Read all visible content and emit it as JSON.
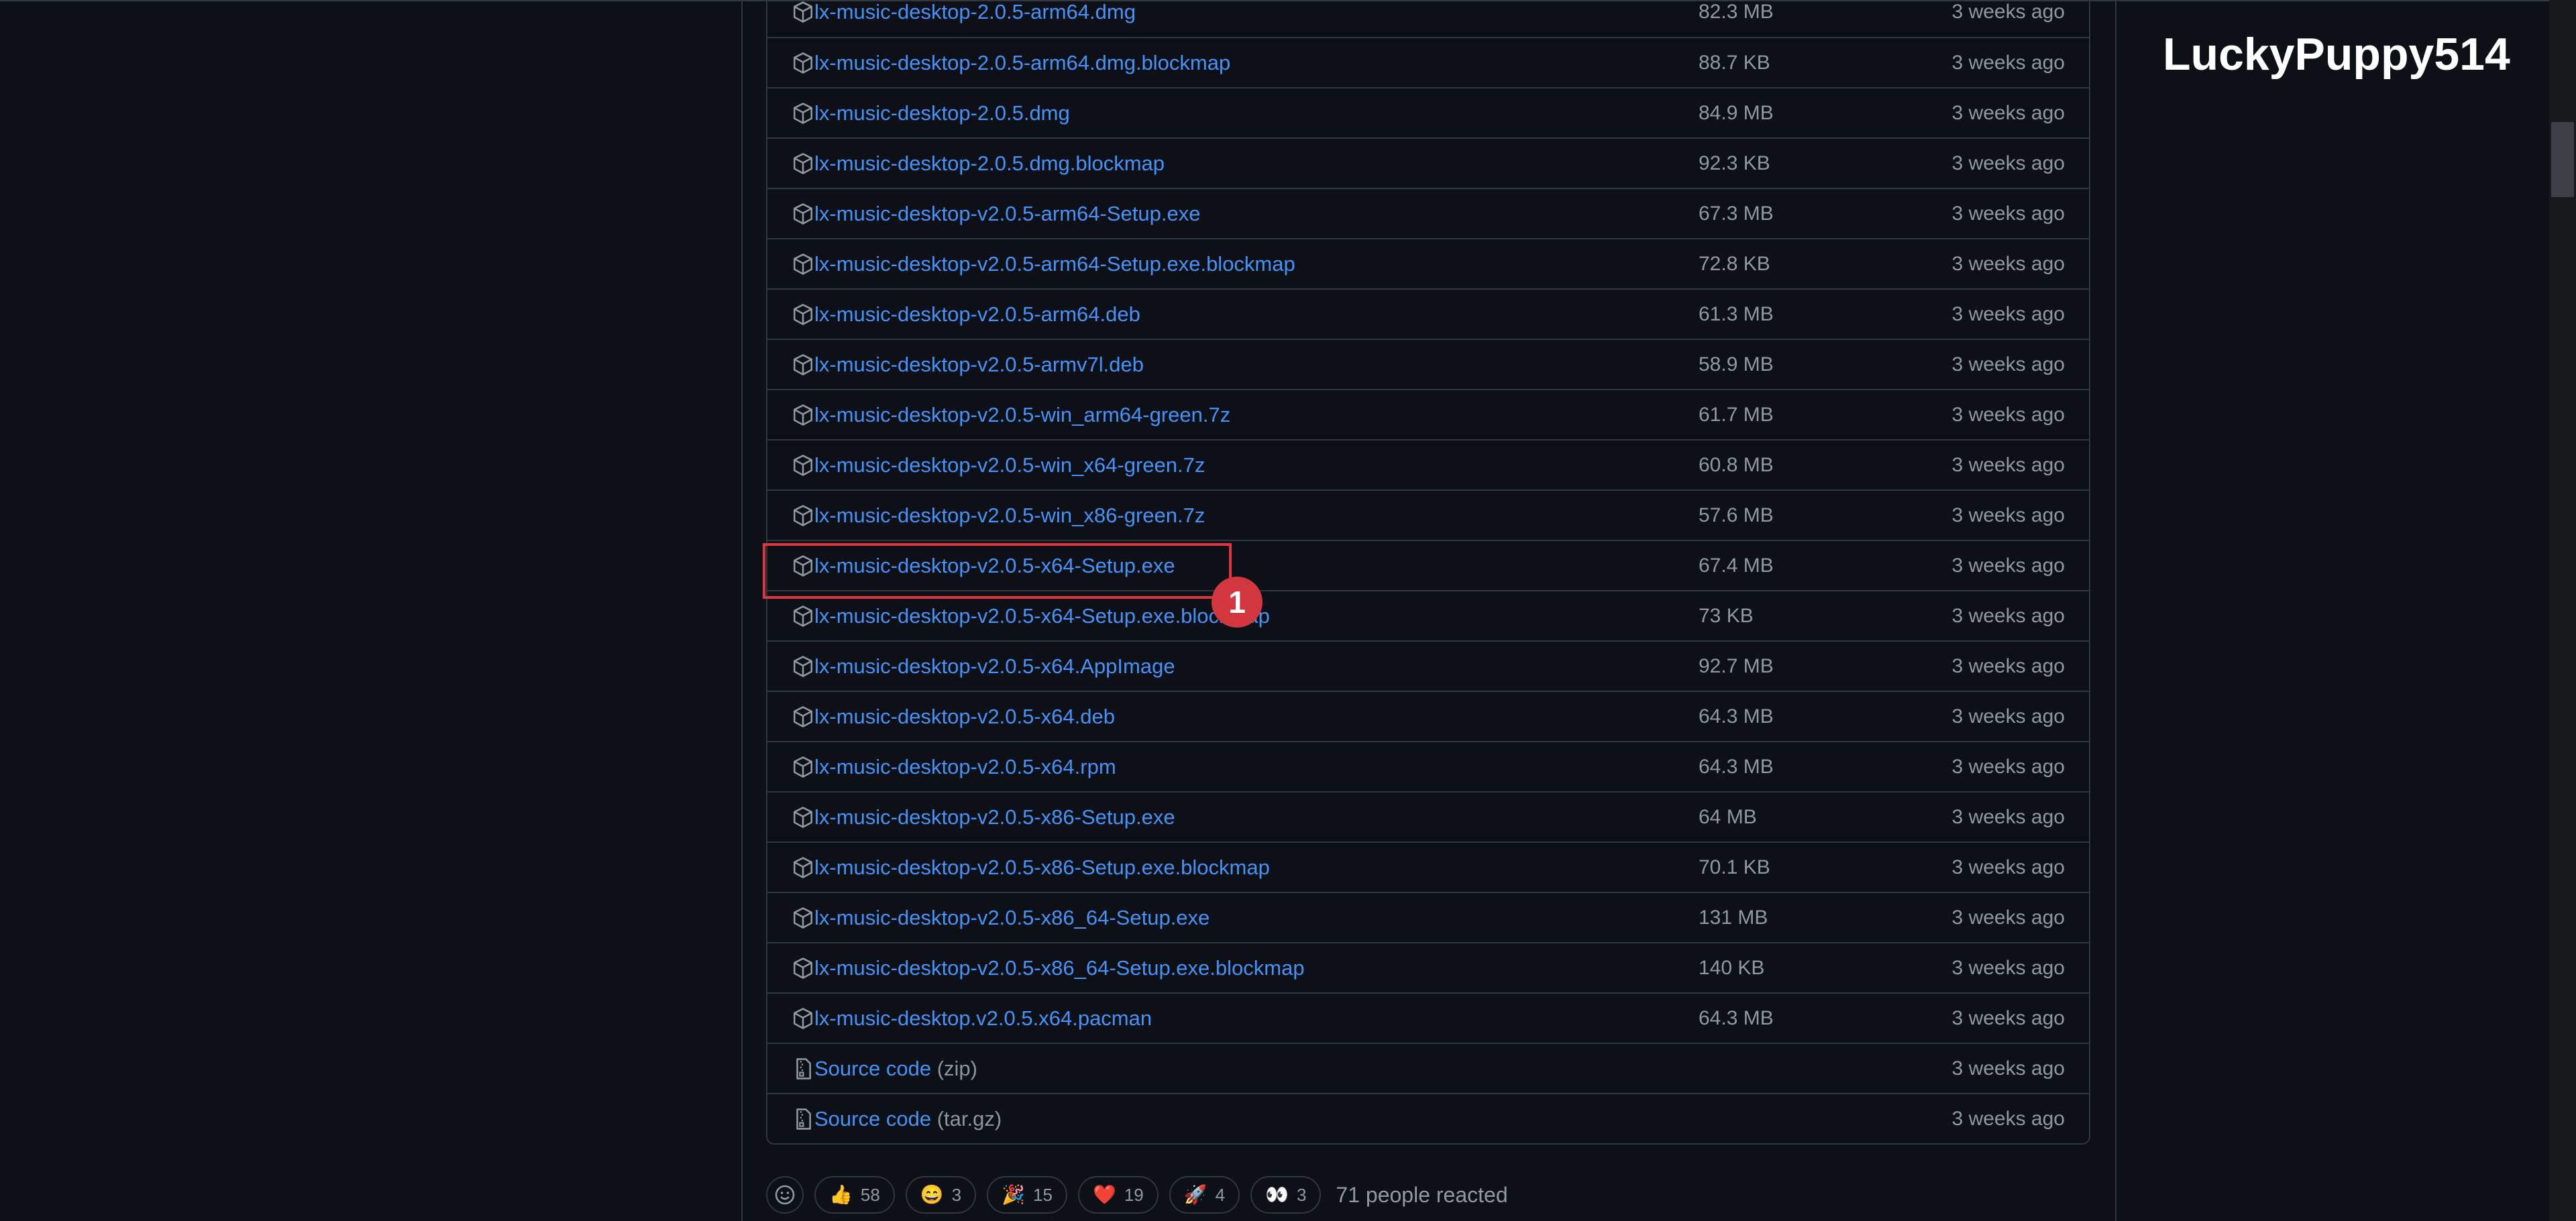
{
  "sidebar": {
    "username": "LuckyPuppy514"
  },
  "assets": [
    {
      "name": "lx-music-desktop-2.0.5-arm64.dmg",
      "size": "82.3 MB",
      "date": "3 weeks ago",
      "icon": "package-icon"
    },
    {
      "name": "lx-music-desktop-2.0.5-arm64.dmg.blockmap",
      "size": "88.7 KB",
      "date": "3 weeks ago",
      "icon": "package-icon"
    },
    {
      "name": "lx-music-desktop-2.0.5.dmg",
      "size": "84.9 MB",
      "date": "3 weeks ago",
      "icon": "package-icon"
    },
    {
      "name": "lx-music-desktop-2.0.5.dmg.blockmap",
      "size": "92.3 KB",
      "date": "3 weeks ago",
      "icon": "package-icon"
    },
    {
      "name": "lx-music-desktop-v2.0.5-arm64-Setup.exe",
      "size": "67.3 MB",
      "date": "3 weeks ago",
      "icon": "package-icon"
    },
    {
      "name": "lx-music-desktop-v2.0.5-arm64-Setup.exe.blockmap",
      "size": "72.8 KB",
      "date": "3 weeks ago",
      "icon": "package-icon"
    },
    {
      "name": "lx-music-desktop-v2.0.5-arm64.deb",
      "size": "61.3 MB",
      "date": "3 weeks ago",
      "icon": "package-icon"
    },
    {
      "name": "lx-music-desktop-v2.0.5-armv7l.deb",
      "size": "58.9 MB",
      "date": "3 weeks ago",
      "icon": "package-icon"
    },
    {
      "name": "lx-music-desktop-v2.0.5-win_arm64-green.7z",
      "size": "61.7 MB",
      "date": "3 weeks ago",
      "icon": "package-icon"
    },
    {
      "name": "lx-music-desktop-v2.0.5-win_x64-green.7z",
      "size": "60.8 MB",
      "date": "3 weeks ago",
      "icon": "package-icon"
    },
    {
      "name": "lx-music-desktop-v2.0.5-win_x86-green.7z",
      "size": "57.6 MB",
      "date": "3 weeks ago",
      "icon": "package-icon"
    },
    {
      "name": "lx-music-desktop-v2.0.5-x64-Setup.exe",
      "size": "67.4 MB",
      "date": "3 weeks ago",
      "icon": "package-icon"
    },
    {
      "name": "lx-music-desktop-v2.0.5-x64-Setup.exe.blockmap",
      "size": "73 KB",
      "date": "3 weeks ago",
      "icon": "package-icon"
    },
    {
      "name": "lx-music-desktop-v2.0.5-x64.AppImage",
      "size": "92.7 MB",
      "date": "3 weeks ago",
      "icon": "package-icon"
    },
    {
      "name": "lx-music-desktop-v2.0.5-x64.deb",
      "size": "64.3 MB",
      "date": "3 weeks ago",
      "icon": "package-icon"
    },
    {
      "name": "lx-music-desktop-v2.0.5-x64.rpm",
      "size": "64.3 MB",
      "date": "3 weeks ago",
      "icon": "package-icon"
    },
    {
      "name": "lx-music-desktop-v2.0.5-x86-Setup.exe",
      "size": "64 MB",
      "date": "3 weeks ago",
      "icon": "package-icon"
    },
    {
      "name": "lx-music-desktop-v2.0.5-x86-Setup.exe.blockmap",
      "size": "70.1 KB",
      "date": "3 weeks ago",
      "icon": "package-icon"
    },
    {
      "name": "lx-music-desktop-v2.0.5-x86_64-Setup.exe",
      "size": "131 MB",
      "date": "3 weeks ago",
      "icon": "package-icon"
    },
    {
      "name": "lx-music-desktop-v2.0.5-x86_64-Setup.exe.blockmap",
      "size": "140 KB",
      "date": "3 weeks ago",
      "icon": "package-icon"
    },
    {
      "name": "lx-music-desktop.v2.0.5.x64.pacman",
      "size": "64.3 MB",
      "date": "3 weeks ago",
      "icon": "package-icon"
    }
  ],
  "source_code": [
    {
      "label": "Source code",
      "format": "(zip)",
      "date": "3 weeks ago",
      "icon": "file-zip-icon"
    },
    {
      "label": "Source code",
      "format": "(tar.gz)",
      "date": "3 weeks ago",
      "icon": "file-zip-icon"
    }
  ],
  "annotation": {
    "badge": "1",
    "color": "#e0343f"
  },
  "reactions": {
    "items": [
      {
        "emoji": "👍",
        "count": "58",
        "icon": "thumbs-up-icon"
      },
      {
        "emoji": "😄",
        "count": "3",
        "icon": "laugh-icon"
      },
      {
        "emoji": "🎉",
        "count": "15",
        "icon": "hooray-icon"
      },
      {
        "emoji": "❤️",
        "count": "19",
        "icon": "heart-icon"
      },
      {
        "emoji": "🚀",
        "count": "4",
        "icon": "rocket-icon"
      },
      {
        "emoji": "👀",
        "count": "3",
        "icon": "eyes-icon"
      }
    ],
    "summary": "71 people reacted"
  },
  "colors": {
    "background": "#0d1117",
    "border": "#30363d",
    "link": "#4493f8",
    "muted": "#9198a1"
  }
}
